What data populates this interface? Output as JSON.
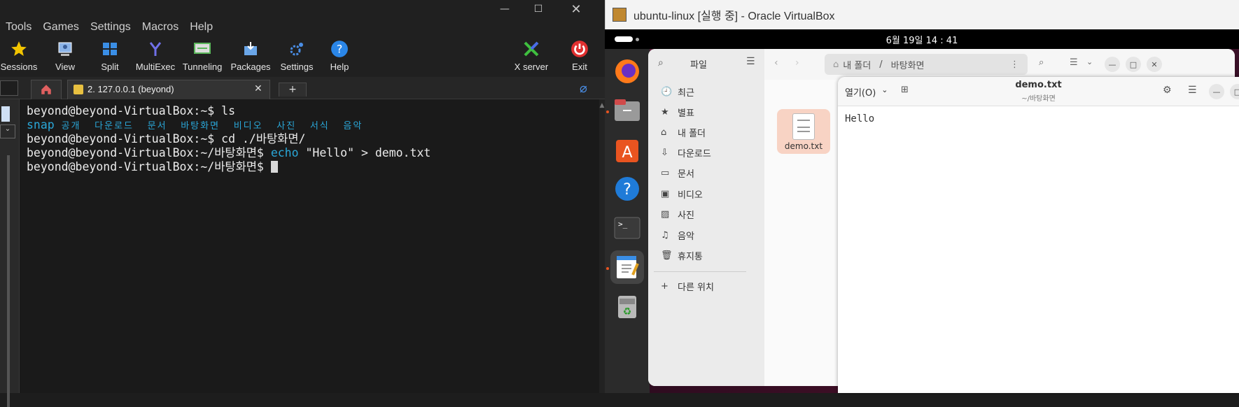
{
  "moba": {
    "menu": [
      "Tools",
      "Games",
      "Settings",
      "Macros",
      "Help"
    ],
    "toolbar": [
      {
        "label": "Sessions",
        "icon": "star-icon",
        "color": "#f2c400"
      },
      {
        "label": "View",
        "icon": "view-icon",
        "color": "#8cb4e8"
      },
      {
        "label": "Split",
        "icon": "split-icon",
        "color": "#3a8ee6"
      },
      {
        "label": "MultiExec",
        "icon": "multiexec-icon",
        "color": "#6a6ae0"
      },
      {
        "label": "Tunneling",
        "icon": "tunneling-icon",
        "color": "#5bb75b"
      },
      {
        "label": "Packages",
        "icon": "packages-icon",
        "color": "#6aa6e8"
      },
      {
        "label": "Settings",
        "icon": "gear-icon",
        "color": "#4a8ee6"
      },
      {
        "label": "Help",
        "icon": "help-icon",
        "color": "#2a86e8"
      },
      {
        "label": "X server",
        "icon": "xserver-icon",
        "color": "#3fbf3f"
      },
      {
        "label": "Exit",
        "icon": "power-icon",
        "color": "#e03030"
      }
    ],
    "tab_label": "2. 127.0.0.1 (beyond)",
    "terminal": {
      "prompt_home": "beyond@beyond-VirtualBox:~$",
      "cmd1": " ls",
      "ls_snap": "snap",
      "ls_items": " 공개  다운로드  문서  바탕화면  비디오  사진  서식  음악",
      "cmd2": " cd ./바탕화면/",
      "prompt_desk": "beyond@beyond-VirtualBox:~/바탕화면$",
      "cmd3_echo": "echo",
      "cmd3_rest": " \"Hello\" > demo.txt"
    }
  },
  "vbox": {
    "title": "ubuntu-linux [실행 중] - Oracle VirtualBox",
    "clock": "6월 19일  14 : 41",
    "files": {
      "header_label": "파일",
      "path_home": "내 폴더",
      "path_sep": "/",
      "path_current": "바탕화면",
      "sidebar": [
        {
          "label": "최근",
          "icon": "clock-icon",
          "glyph": "🕘"
        },
        {
          "label": "별표",
          "icon": "star-icon",
          "glyph": "★"
        },
        {
          "label": "내 폴더",
          "icon": "home-icon",
          "glyph": "⌂"
        },
        {
          "label": "다운로드",
          "icon": "download-icon",
          "glyph": "⇩"
        },
        {
          "label": "문서",
          "icon": "document-icon",
          "glyph": "▭"
        },
        {
          "label": "비디오",
          "icon": "video-icon",
          "glyph": "▣"
        },
        {
          "label": "사진",
          "icon": "photo-icon",
          "glyph": "▨"
        },
        {
          "label": "음악",
          "icon": "music-icon",
          "glyph": "♫"
        },
        {
          "label": "휴지통",
          "icon": "trash-icon",
          "glyph": "🗑"
        }
      ],
      "other_locations": "다른 위치",
      "file_name": "demo.txt"
    },
    "editor": {
      "open_label": "열기(O)",
      "title": "demo.txt",
      "subtitle": "~/바탕화면",
      "content": "Hello"
    }
  }
}
